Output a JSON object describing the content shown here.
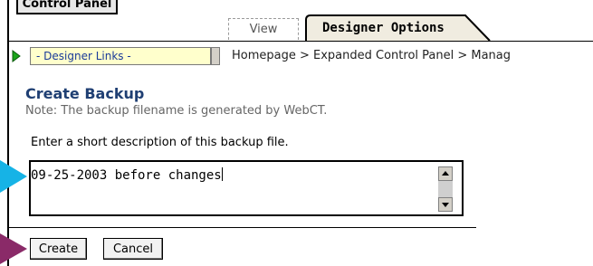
{
  "header": {
    "control_panel_label": "Control Panel"
  },
  "tabs": [
    {
      "label": "View"
    },
    {
      "label": "Designer Options"
    }
  ],
  "designer_links": {
    "selected": "- Designer Links -"
  },
  "breadcrumb": "Homepage > Expanded Control Panel > Manag",
  "page": {
    "title": "Create Backup",
    "note": "Note: The backup filename is generated by WebCT.",
    "description_label": "Enter a short description of this backup file.",
    "description_value": "09-25-2003 before changes"
  },
  "buttons": {
    "create_label": "Create",
    "cancel_label": "Cancel"
  },
  "colors": {
    "cyan_pointer": "#16b3e6",
    "purple_pointer": "#8a2a68",
    "tab_fill": "#f0ece0",
    "select_fill": "#ffffcc"
  },
  "icons": [
    "arrow-right-icon",
    "scroll-up-icon",
    "scroll-down-icon",
    "pointer-arrow-icon"
  ]
}
